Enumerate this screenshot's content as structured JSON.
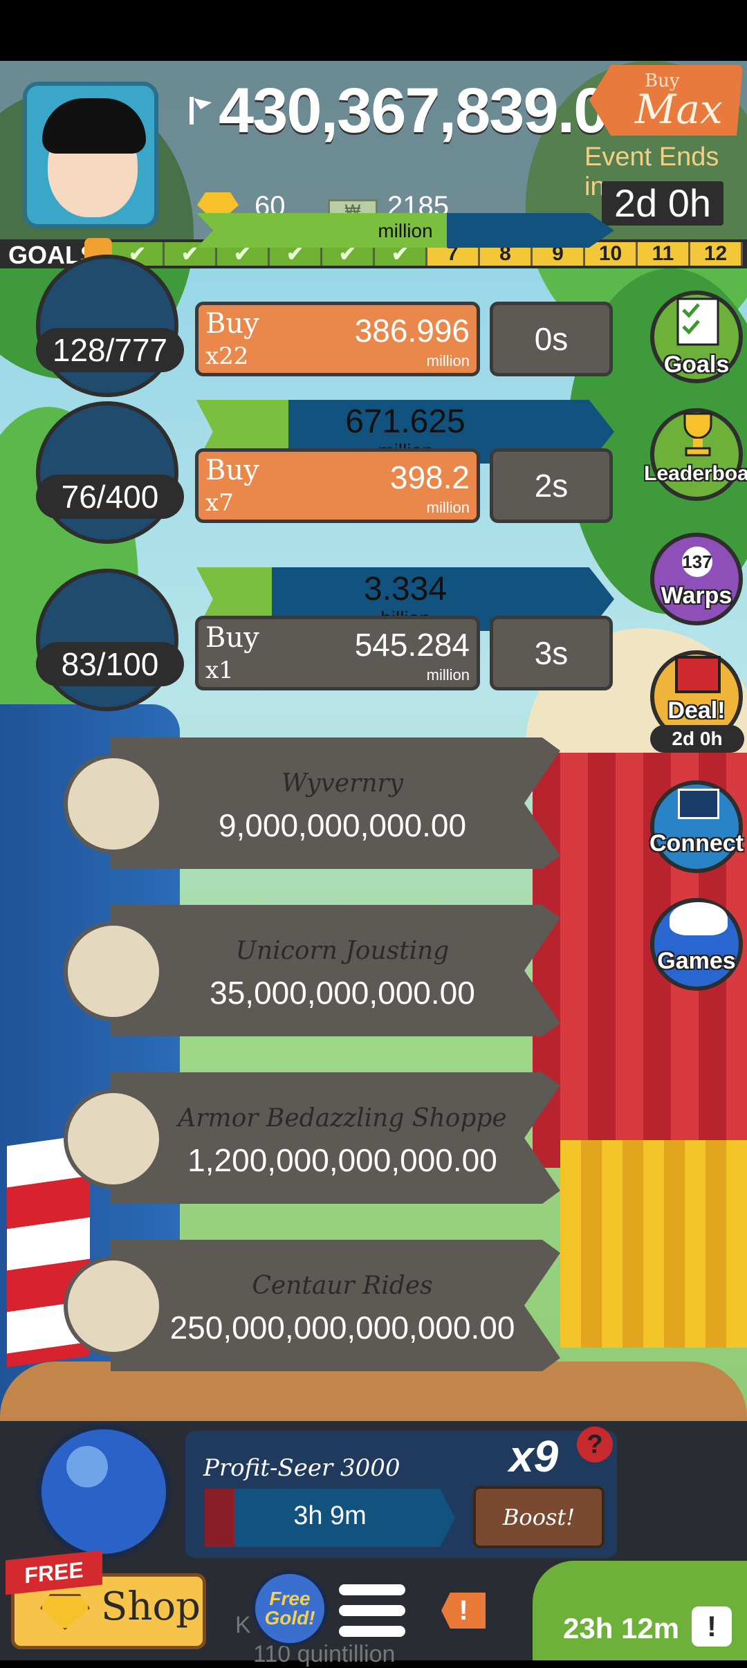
{
  "header": {
    "money": "430,367,839.01",
    "buy_max_small": "Buy",
    "buy_max_big": "Max",
    "event_label": "Event Ends in:",
    "event_time": "2d 0h",
    "gold_count": "60",
    "megabucks_count": "2185"
  },
  "goals": {
    "label": "GOALS",
    "cells": [
      "",
      "",
      "",
      "",
      "",
      "",
      "7",
      "8",
      "9",
      "10",
      "11",
      "12"
    ],
    "completed": 6
  },
  "businesses": [
    {
      "count": "128/777",
      "bar_value": "",
      "bar_unit": "million",
      "progress": 0.6,
      "buy_label": "Buy",
      "buy_multiplier": "x22",
      "buy_cost": "386.996",
      "buy_unit": "million",
      "time": "0s"
    },
    {
      "count": "76/400",
      "bar_value": "671.625",
      "bar_unit": "million",
      "progress": 0.22,
      "buy_label": "Buy",
      "buy_multiplier": "x7",
      "buy_cost": "398.2",
      "buy_unit": "million",
      "time": "2s"
    },
    {
      "count": "83/100",
      "bar_value": "3.334",
      "bar_unit": "billion",
      "progress": 0.18,
      "buy_label": "Buy",
      "buy_multiplier": "x1",
      "buy_cost": "545.284",
      "buy_unit": "million",
      "time": "3s"
    }
  ],
  "locked": [
    {
      "name": "Wyvernry",
      "cost": "9,000,000,000.00"
    },
    {
      "name": "Unicorn Jousting",
      "cost": "35,000,000,000.00"
    },
    {
      "name": "Armor Bedazzling Shoppe",
      "cost": "1,200,000,000,000.00"
    },
    {
      "name": "Centaur Rides",
      "cost": "250,000,000,000,000.00"
    }
  ],
  "side_menu": {
    "goals": "Goals",
    "leaderboard": "Leaderboard",
    "warps_count": "137",
    "warps": "Warps",
    "deal": "Deal!",
    "deal_time": "2d 0h",
    "connect": "Connect",
    "games": "Games"
  },
  "manager": {
    "name": "Profit-Seer 3000",
    "multiplier": "x9",
    "help": "?",
    "time": "3h 9m",
    "progress": 0.12,
    "boost": "Boost!"
  },
  "footer": {
    "free": "FREE",
    "shop": "Shop",
    "free_gold": "Free Gold!",
    "alert": "!",
    "timer": "23h 12m",
    "timer_icon": "!",
    "under_1": "K",
    "under_2": "110 quintillion"
  },
  "colors": {
    "accent": "#e9884a",
    "bar": "#11527e",
    "fill": "#7bbf3e"
  }
}
